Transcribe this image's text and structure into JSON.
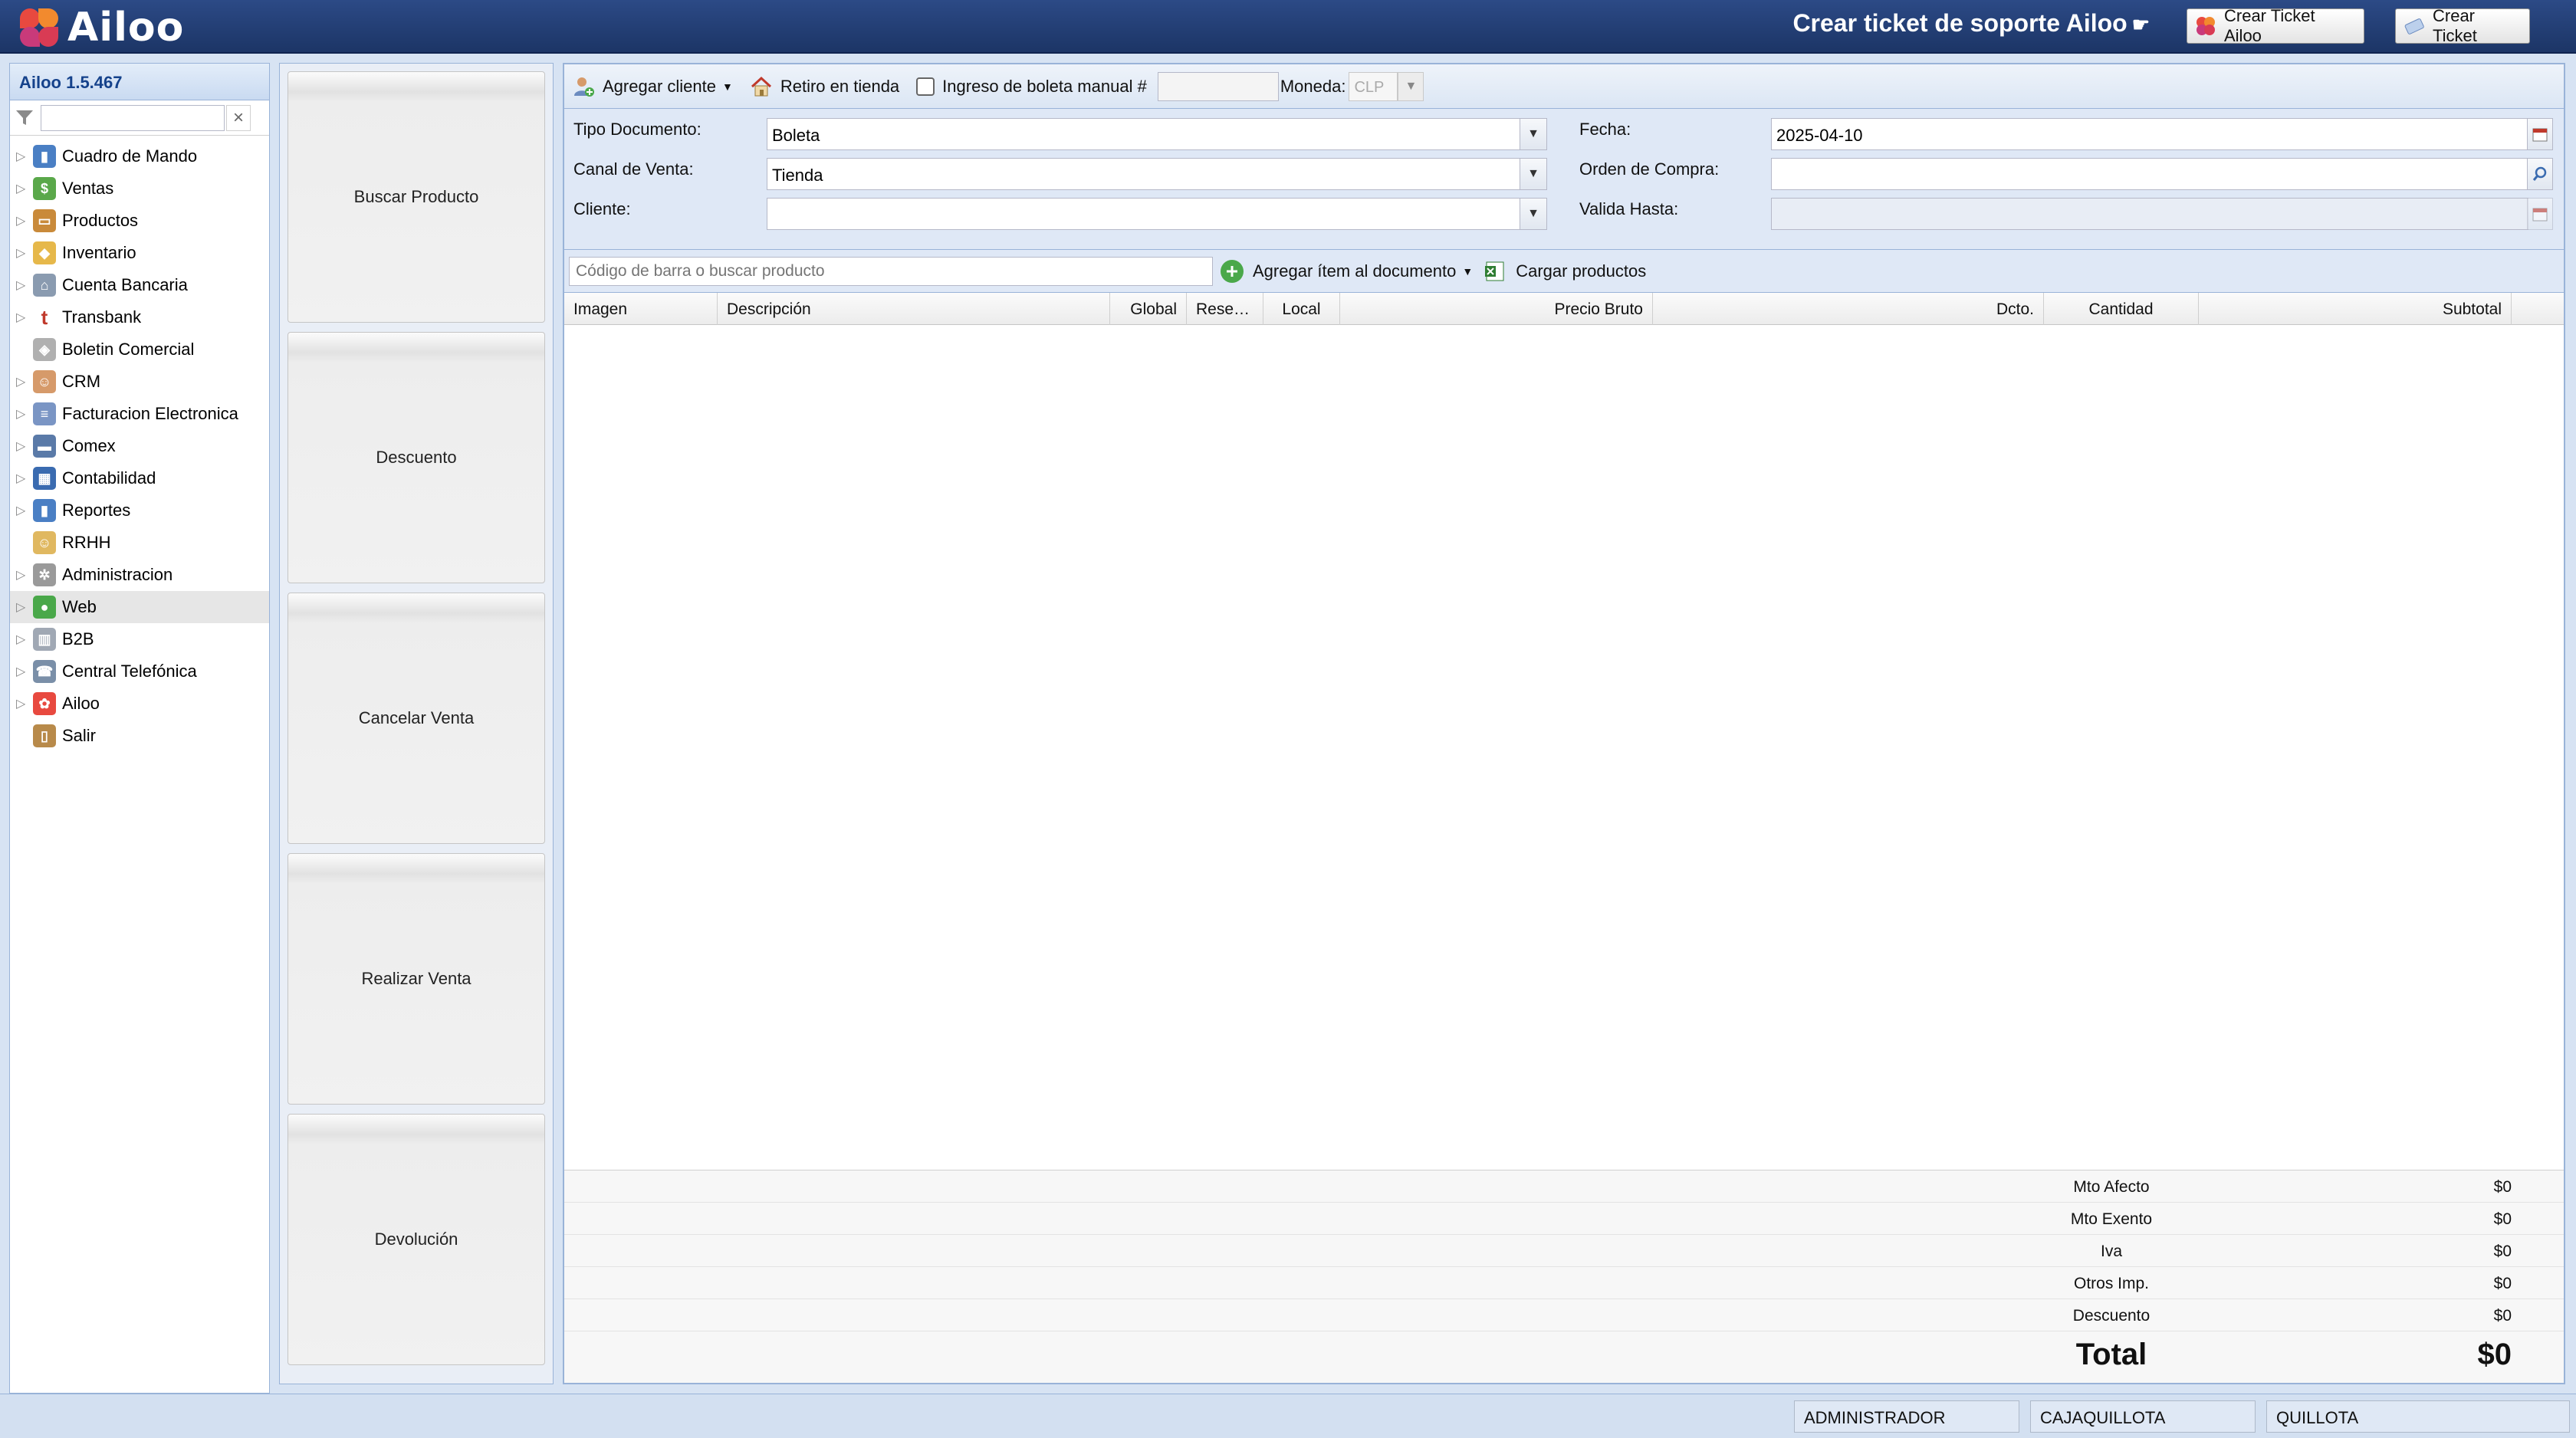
{
  "app": {
    "logo_text": "Ailoo",
    "support_title": "Crear ticket de soporte Ailoo",
    "btn_ticket_ailoo": "Crear Ticket Ailoo",
    "btn_ticket": "Crear Ticket"
  },
  "nav": {
    "version": "Ailoo 1.5.467",
    "filter_value": "",
    "items": [
      {
        "label": "Cuadro de Mando",
        "icon": "dashboard-icon",
        "expandable": true
      },
      {
        "label": "Ventas",
        "icon": "money-icon",
        "expandable": true
      },
      {
        "label": "Productos",
        "icon": "box-icon",
        "expandable": true
      },
      {
        "label": "Inventario",
        "icon": "package-icon",
        "expandable": true
      },
      {
        "label": "Cuenta Bancaria",
        "icon": "bank-icon",
        "expandable": true
      },
      {
        "label": "Transbank",
        "icon": "transbank-icon",
        "expandable": true
      },
      {
        "label": "Boletin Comercial",
        "icon": "tag-icon",
        "expandable": false
      },
      {
        "label": "CRM",
        "icon": "users-icon",
        "expandable": true
      },
      {
        "label": "Facturacion Electronica",
        "icon": "invoice-icon",
        "expandable": true
      },
      {
        "label": "Comex",
        "icon": "truck-icon",
        "expandable": true
      },
      {
        "label": "Contabilidad",
        "icon": "calculator-icon",
        "expandable": true
      },
      {
        "label": "Reportes",
        "icon": "chart-icon",
        "expandable": true
      },
      {
        "label": "RRHH",
        "icon": "folder-users-icon",
        "expandable": false
      },
      {
        "label": "Administracion",
        "icon": "gear-icon",
        "expandable": true
      },
      {
        "label": "Web",
        "icon": "globe-icon",
        "expandable": true
      },
      {
        "label": "B2B",
        "icon": "building-icon",
        "expandable": true
      },
      {
        "label": "Central Telefónica",
        "icon": "phone-icon",
        "expandable": true
      },
      {
        "label": "Ailoo",
        "icon": "ailoo-icon",
        "expandable": true
      },
      {
        "label": "Salir",
        "icon": "door-icon",
        "expandable": false
      }
    ]
  },
  "actions": {
    "buscar": "Buscar Producto",
    "descuento": "Descuento",
    "cancelar": "Cancelar Venta",
    "realizar": "Realizar Venta",
    "devolucion": "Devolución"
  },
  "toolbar": {
    "agregar_cliente": "Agregar cliente",
    "retiro": "Retiro en tienda",
    "ingreso_manual": "Ingreso de boleta manual #",
    "ingreso_manual_checked": false,
    "manual_value": "",
    "moneda_label": "Moneda:",
    "moneda_value": "CLP"
  },
  "form": {
    "tipo_documento_label": "Tipo Documento:",
    "tipo_documento_value": "Boleta",
    "canal_label": "Canal de Venta:",
    "canal_value": "Tienda",
    "cliente_label": "Cliente:",
    "cliente_value": "",
    "fecha_label": "Fecha:",
    "fecha_value": "2025-04-10",
    "orden_label": "Orden de Compra:",
    "orden_value": "",
    "valida_label": "Valida Hasta:",
    "valida_value": ""
  },
  "search": {
    "placeholder": "Código de barra o buscar producto",
    "agregar_item": "Agregar ítem al documento",
    "cargar": "Cargar productos"
  },
  "grid": {
    "columns": [
      "Imagen",
      "Descripción",
      "Global",
      "Rese…",
      "Local",
      "Precio Bruto",
      "Dcto.",
      "Cantidad",
      "Subtotal"
    ],
    "rows": []
  },
  "totals": {
    "afecto_label": "Mto Afecto",
    "afecto": "$0",
    "exento_label": "Mto Exento",
    "exento": "$0",
    "iva_label": "Iva",
    "iva": "$0",
    "otros_label": "Otros Imp.",
    "otros": "$0",
    "descuento_label": "Descuento",
    "descuento": "$0",
    "total_label": "Total",
    "total": "$0"
  },
  "status": {
    "user": "ADMINISTRADOR",
    "caja": "CAJAQUILLOTA",
    "sucursal": "QUILLOTA"
  }
}
